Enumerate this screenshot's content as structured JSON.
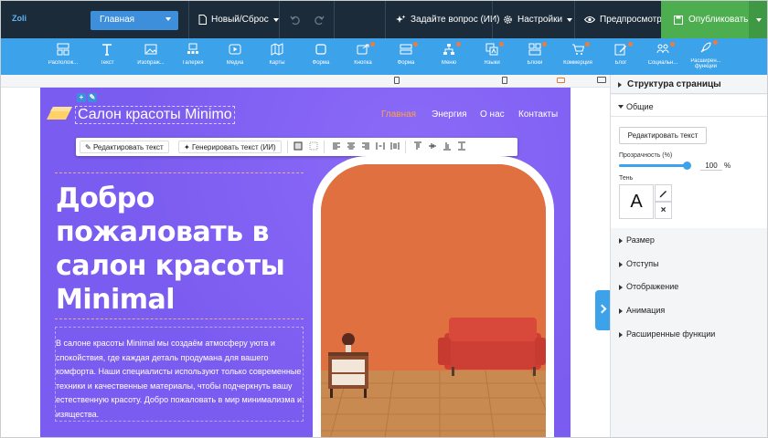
{
  "topbar": {
    "logo": "Zoli",
    "page_select": "Главная",
    "new_reset": "Новый/Сброс",
    "ask_ai": "Задайте вопрос (ИИ)",
    "settings": "Настройки",
    "preview": "Предпросмотр",
    "publish": "Опубликовать"
  },
  "toolbar": {
    "items": [
      {
        "label": "Располож...",
        "icon": "layout-icon",
        "dot": false
      },
      {
        "label": "Текст",
        "icon": "text-icon",
        "dot": false
      },
      {
        "label": "Изображ...",
        "icon": "image-icon",
        "dot": false
      },
      {
        "label": "Галерея",
        "icon": "gallery-icon",
        "dot": false
      },
      {
        "label": "Медиа",
        "icon": "media-icon",
        "dot": false
      },
      {
        "label": "Карты",
        "icon": "map-icon",
        "dot": false
      },
      {
        "label": "Форма",
        "icon": "shape-icon",
        "dot": false
      },
      {
        "label": "Кнопка",
        "icon": "button-icon",
        "dot": true
      },
      {
        "label": "Форма",
        "icon": "form-icon",
        "dot": true
      },
      {
        "label": "Меню",
        "icon": "menu-icon",
        "dot": true
      },
      {
        "label": "Языки",
        "icon": "languages-icon",
        "dot": true
      },
      {
        "label": "Блоки",
        "icon": "blocks-icon",
        "dot": true
      },
      {
        "label": "Коммерция",
        "icon": "cart-icon",
        "dot": true
      },
      {
        "label": "Блог",
        "icon": "blog-icon",
        "dot": true
      },
      {
        "label": "Социальн...",
        "icon": "social-icon",
        "dot": true
      },
      {
        "label": "Расширен... функции",
        "icon": "rocket-icon",
        "dot": true
      }
    ]
  },
  "site": {
    "brand": "Салон красоты Minimo",
    "nav": [
      "Главная",
      "Энергия",
      "О нас",
      "Контакты"
    ],
    "nav_active_color": "#ffa24a",
    "text_toolbar": {
      "edit_text": "Редактировать текст",
      "generate_text": "Генерировать текст (ИИ)"
    },
    "hero_title": "Добро пожаловать в салон красоты Minimal",
    "hero_text": "В салоне красоты Minimal мы создаём атмосферу уюта и спокойствия, где каждая деталь продумана для вашего комфорта. Наши специалисты используют только современные техники и качественные материалы, чтобы подчеркнуть вашу естественную красоту. Добро пожаловать в мир минимализма и изящества.",
    "background_color": "#7b5cf0"
  },
  "panel": {
    "title": "Структура страницы",
    "general": "Общие",
    "edit_text_button": "Редактировать текст",
    "opacity_label": "Прозрачность (%)",
    "opacity_value": "100",
    "opacity_unit": "%",
    "shadow_label": "Тень",
    "shadow_preview": "A",
    "shadow_clear": "×",
    "sections": [
      "Размер",
      "Отступы",
      "Отображение",
      "Анимация",
      "Расширенные функции"
    ]
  },
  "colors": {
    "topbar": "#1c2b3a",
    "toolbar": "#3ca2ea",
    "publish": "#4cae4f",
    "accent": "#3d8fdb"
  }
}
